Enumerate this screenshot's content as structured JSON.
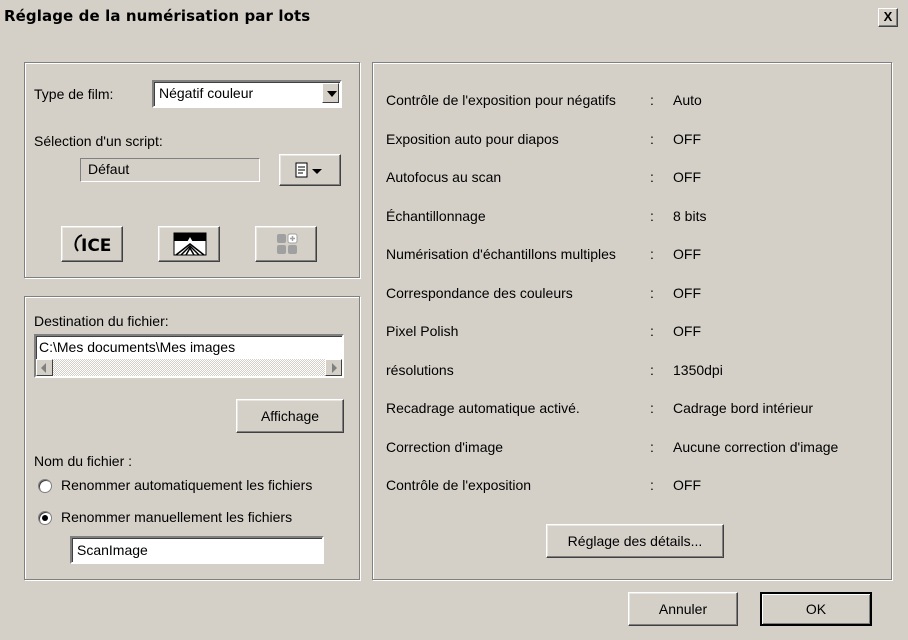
{
  "window": {
    "title": "Réglage de la numérisation par lots",
    "close_label": "X"
  },
  "film": {
    "type_label": "Type de film:",
    "type_value": "Négatif couleur",
    "script_label": "Sélection d'un script:",
    "script_value": "Défaut"
  },
  "tools": {
    "ice_label": "ICE",
    "ice_icon": "ice-icon",
    "dust_icon": "digital-filter-icon",
    "grid_icon": "multi-image-icon",
    "script_menu_icon": "script-menu-icon"
  },
  "destination": {
    "label": "Destination du fichier:",
    "path": "C:\\Mes documents\\Mes images",
    "view_button": "Affichage"
  },
  "filename": {
    "label": "Nom du fichier :",
    "options": [
      {
        "label": "Renommer automatiquement les fichiers",
        "selected": false
      },
      {
        "label": "Renommer manuellement les fichiers",
        "selected": true
      }
    ],
    "value": "ScanImage"
  },
  "settings": [
    {
      "key": "Contrôle de l'exposition pour négatifs",
      "sep": ":",
      "value": "Auto"
    },
    {
      "key": "Exposition auto pour diapos",
      "sep": ":",
      "value": "OFF"
    },
    {
      "key": "Autofocus au scan",
      "sep": ":",
      "value": "OFF"
    },
    {
      "key": "Échantillonnage",
      "sep": ":",
      "value": "8 bits"
    },
    {
      "key": "Numérisation d'échantillons multiples",
      "sep": ":",
      "value": "OFF"
    },
    {
      "key": "Correspondance des couleurs",
      "sep": ":",
      "value": "OFF"
    },
    {
      "key": "Pixel Polish",
      "sep": ":",
      "value": "OFF"
    },
    {
      "key": "résolutions",
      "sep": ":",
      "value": "1350dpi"
    },
    {
      "key": "Recadrage automatique activé.",
      "sep": ":",
      "value": "Cadrage bord intérieur"
    },
    {
      "key": "Correction d'image",
      "sep": ":",
      "value": "Aucune correction d'image"
    },
    {
      "key": "Contrôle de l'exposition",
      "sep": ":",
      "value": "OFF"
    }
  ],
  "buttons": {
    "details": "Réglage des détails...",
    "cancel": "Annuler",
    "ok": "OK"
  },
  "colors": {
    "face": "#d4d0c8",
    "shadow": "#808080",
    "highlight": "#ffffff"
  }
}
